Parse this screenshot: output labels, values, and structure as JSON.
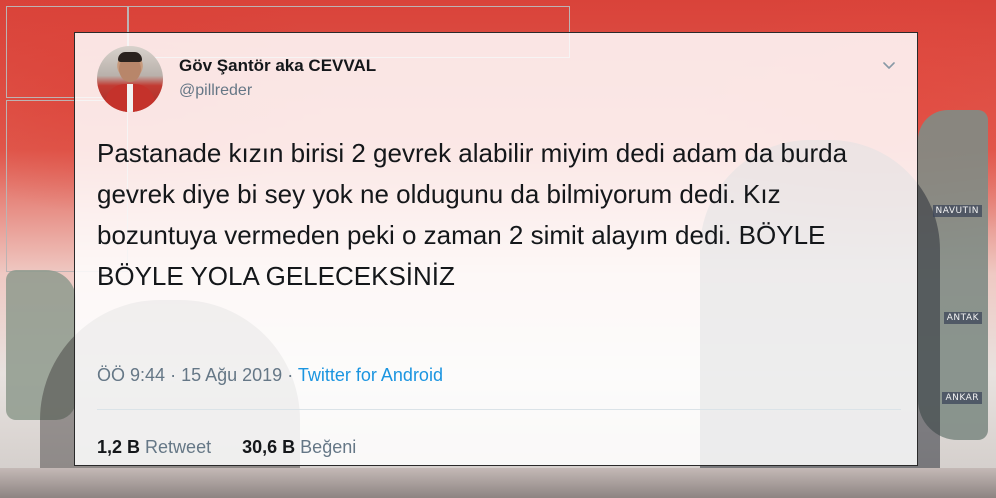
{
  "background": {
    "signs": [
      "NAVUTIN",
      "ANTAK",
      "ANKAR"
    ],
    "accent_red": "#d9433a"
  },
  "tweet": {
    "display_name": "Göv Şantör aka CEVVAL",
    "handle": "@pillreder",
    "menu_icon": "chevron-down-icon",
    "text": "Pastanade kızın birisi 2 gevrek alabilir miyim dedi adam da burda gevrek diye bi sey yok ne oldugunu da bilmiyorum dedi. Kız bozuntuya vermeden peki o zaman 2 simit alayım dedi. BÖYLE BÖYLE YOLA GELECEKSİNİZ",
    "time": "ÖÖ 9:44",
    "separator": "·",
    "date": "15 Ağu 2019",
    "source": "Twitter for Android",
    "retweets": {
      "count": "1,2 B",
      "label": "Retweet"
    },
    "likes": {
      "count": "30,6 B",
      "label": "Beğeni"
    },
    "colors": {
      "text": "#14171a",
      "secondary": "#657786",
      "link": "#1b95e0"
    }
  }
}
